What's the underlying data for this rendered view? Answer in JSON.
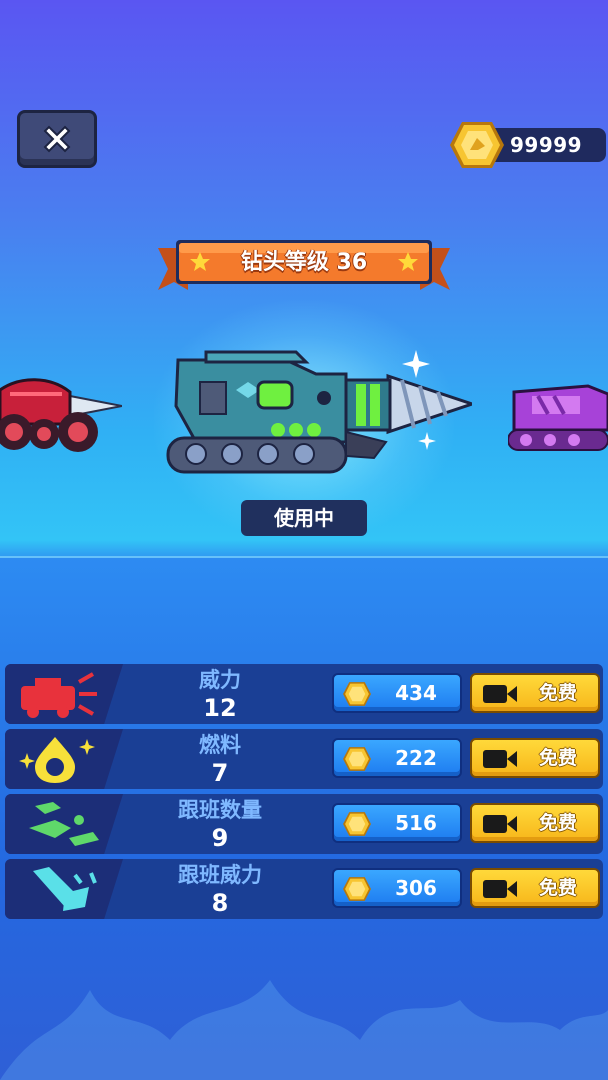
{
  "colors": {
    "accent_orange": "#f47a2c",
    "coin_gold": "#f7c531",
    "free_yellow": "#ffd93a",
    "cost_blue": "#2a8ef5",
    "row_bg": "#1a3f95",
    "row_name": "#7fb8ff"
  },
  "header": {
    "close_icon": "close-x-icon",
    "coin_icon": "gold-coin-icon",
    "coin_count": "99999"
  },
  "banner": {
    "title": "钻头等级 36"
  },
  "showcase": {
    "current_status": "使用中",
    "vehicles": [
      "red-drill-car",
      "teal-drill-tank",
      "purple-tank"
    ]
  },
  "upgrades": [
    {
      "name": "威力",
      "level": "12",
      "cost": "434",
      "free_label": "免费",
      "icon": "power-cannon-icon"
    },
    {
      "name": "燃料",
      "level": "7",
      "cost": "222",
      "free_label": "免费",
      "icon": "fuel-drop-icon"
    },
    {
      "name": "跟班数量",
      "level": "9",
      "cost": "516",
      "free_label": "免费",
      "icon": "follower-count-icon"
    },
    {
      "name": "跟班威力",
      "level": "8",
      "cost": "306",
      "free_label": "免费",
      "icon": "follower-power-icon"
    }
  ]
}
